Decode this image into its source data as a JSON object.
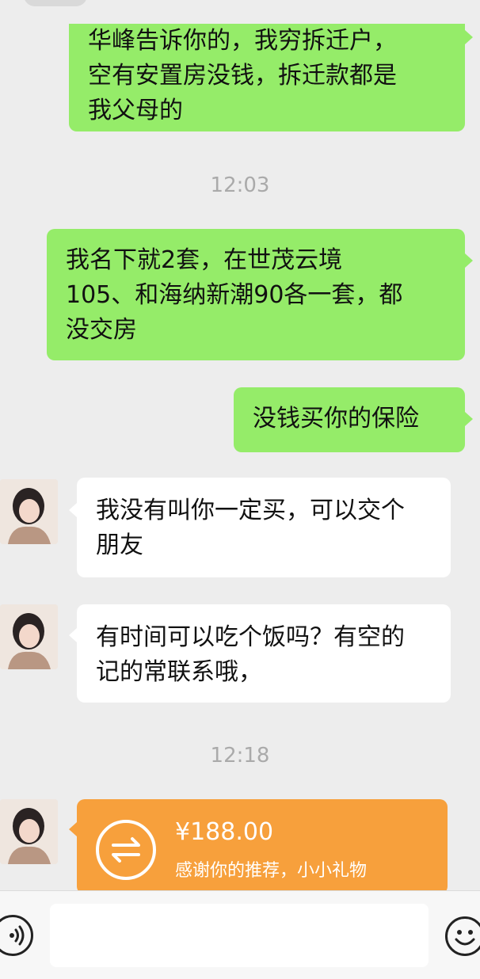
{
  "header": {
    "title_fragment": "…"
  },
  "messages": {
    "m1": "华峰告诉你的，我穷拆迁户，\n空有安置房没钱，拆迁款都是\n我父母的",
    "t1": "12:03",
    "m2": "我名下就2套，在世茂云境\n105、和海纳新潮90各一套，都\n没交房",
    "m3": "没钱买你的保险",
    "m4": "我没有叫你一定买，可以交个\n朋友",
    "m5": "有时间可以吃个饭吗？有空的\n记的常联系哦，",
    "t2": "12:18"
  },
  "transfer": {
    "amount": "¥188.00",
    "note": "感谢你的推荐，小小礼物",
    "icon": "transfer-icon"
  },
  "input_bar": {
    "voice_icon": "voice-icon",
    "placeholder": "",
    "emoji_icon": "emoji-icon"
  },
  "colors": {
    "background": "#ededed",
    "my_bubble": "#95ec69",
    "their_bubble": "#ffffff",
    "transfer": "#f7a03c",
    "timestamp": "#aaaaaa"
  }
}
